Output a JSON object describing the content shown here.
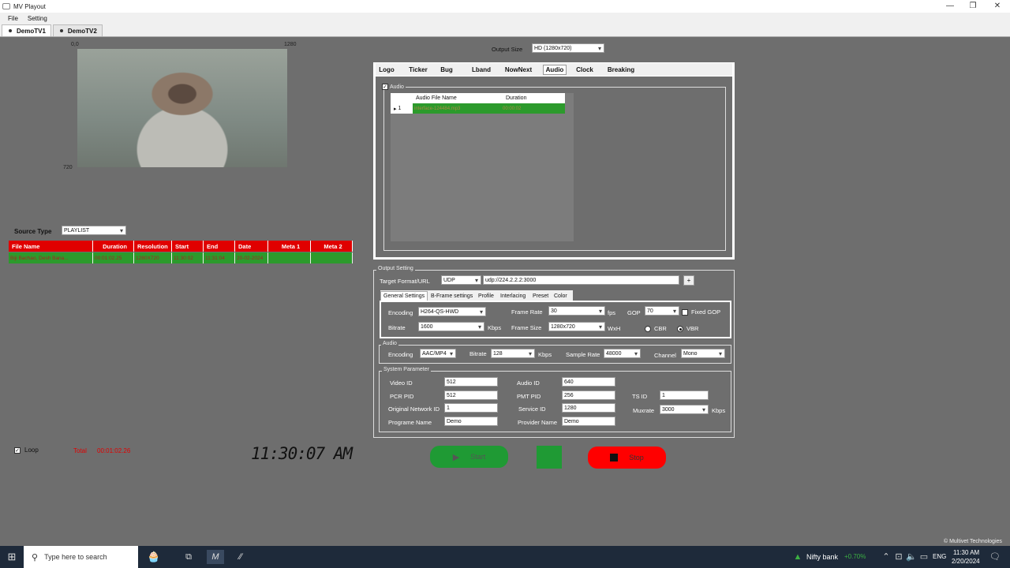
{
  "window": {
    "title": "MV Playout",
    "min": "—",
    "max": "❐",
    "close": "✕"
  },
  "menu": [
    "File",
    "Setting"
  ],
  "channel_tabs": [
    "DemoTV1",
    "DemoTV2"
  ],
  "preview": {
    "x0": "0,0",
    "x1": "1280",
    "y1": "720"
  },
  "output_size": {
    "label": "Output Size",
    "value": "HD (1280x720)"
  },
  "panel_tabs": [
    "Logo",
    "Ticker",
    "Bug",
    "Lband",
    "NowNext",
    "Audio",
    "Clock",
    "Breaking"
  ],
  "audio": {
    "checkbox_label": "Audio",
    "col_name": "Audio File Name",
    "col_duration": "Duration",
    "rows": [
      {
        "index": "1",
        "name": "interface-124484.mp3",
        "duration": "00:00:02"
      }
    ]
  },
  "source": {
    "label": "Source Type",
    "value": "PLAYLIST"
  },
  "playlist": {
    "headers": [
      "File Name",
      "Duration",
      "Resolution",
      "Start",
      "End",
      "Date",
      "Meta 1",
      "Meta 2"
    ],
    "rows": [
      [
        "Biji Bachao, Desh Bana...",
        "00:01:02.25",
        "1280X720",
        "11:30:02",
        "11:31:04",
        "20-02-2024",
        "",
        ""
      ]
    ]
  },
  "loop": {
    "label": "Loop",
    "total_label": "Total",
    "total_value": "00:01:02.26"
  },
  "clock": "11:30:07 AM",
  "output_setting": {
    "title": "Output Setting",
    "target_label": "Target Format/URL",
    "format": "UDP",
    "url": "udp://224.2.2.2:3000",
    "plus": "+",
    "subtabs": [
      "General Settings",
      "B-Frame settings",
      "Profile",
      "Interlacing",
      "Preset",
      "Color"
    ],
    "encoding_label": "Encoding",
    "encoding": "H264-QS-HWD",
    "bitrate_label": "Bitrate",
    "bitrate": "1600",
    "kbps": "Kbps",
    "framerate_label": "Frame Rate",
    "framerate": "30",
    "fps": "fps",
    "framesize_label": "Frame Size",
    "framesize": "1280x720",
    "wxh": "WxH",
    "gop_label": "GOP",
    "gop": "70",
    "fixed_gop": "Fixed GOP",
    "cbr": "CBR",
    "vbr": "VBR"
  },
  "audio_out": {
    "title": "Audio",
    "encoding_label": "Encoding",
    "encoding": "AAC/MP4",
    "bitrate_label": "Bitrate",
    "bitrate": "128",
    "kbps": "Kbps",
    "samplerate_label": "Sample Rate",
    "samplerate": "48000",
    "channel_label": "Channel",
    "channel": "Mono"
  },
  "system": {
    "title": "System Parameter",
    "video_id_label": "Video ID",
    "video_id": "512",
    "pcr_pid_label": "PCR PID",
    "pcr_pid": "512",
    "onid_label": "Original Network ID",
    "onid": "1",
    "program_label": "Programe Name",
    "program": "Demo",
    "audio_id_label": "Audio ID",
    "audio_id": "640",
    "pmt_pid_label": "PMT PID",
    "pmt_pid": "256",
    "service_id_label": "Service ID",
    "service_id": "1280",
    "provider_label": "Provider Name",
    "provider": "Demo",
    "ts_id_label": "TS ID",
    "ts_id": "1",
    "muxrate_label": "Muxrate",
    "muxrate": "3000",
    "muxrate_unit": "Kbps"
  },
  "controls": {
    "start": "Start",
    "stop": "Stop"
  },
  "footer": "© Multivet Technologies",
  "taskbar": {
    "search": "Type here to search",
    "ticker_name": "Nifty bank",
    "ticker_change": "+0.70%",
    "lang": "ENG",
    "time": "11:30 AM",
    "date": "2/20/2024"
  },
  "colors": {
    "green": "#2c9a2c",
    "red": "#e00000",
    "panel_bg": "#6e6e6e"
  }
}
